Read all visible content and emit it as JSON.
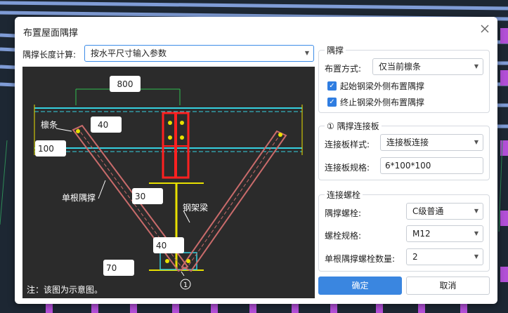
{
  "dialog": {
    "title": "布置屋面隅撑",
    "length_calc_label": "隅撑长度计算:",
    "length_calc_value": "按水平尺寸输入参数"
  },
  "diagram": {
    "dim_800": "800",
    "dim_40_top": "40",
    "dim_100": "100",
    "purlin_label": "檩条",
    "single_brace_label": "单根隅撑",
    "dim_30": "30",
    "steel_beam_label": "钢架梁",
    "dim_40_mid": "40",
    "dim_70": "70",
    "circle_marker": "1",
    "note": "注：该图为示意图。"
  },
  "brace_group": {
    "title": "隅撑",
    "layout_label": "布置方式:",
    "layout_value": "仅当前檩条",
    "check_start": "起始钢梁外侧布置隅撑",
    "check_end": "终止钢梁外侧布置隅撑",
    "check_start_checked": true,
    "check_end_checked": true
  },
  "plate_group": {
    "title": "① 隅撑连接板",
    "style_label": "连接板样式:",
    "style_value": "连接板连接",
    "spec_label": "连接板规格:",
    "spec_value": "6*100*100"
  },
  "bolt_group": {
    "title": "连接螺栓",
    "brace_bolt_label": "隅撑螺栓:",
    "brace_bolt_value": "C级普通",
    "bolt_spec_label": "螺栓规格:",
    "bolt_spec_value": "M12",
    "bolt_count_label": "单根隅撑螺栓数量:",
    "bolt_count_value": "2"
  },
  "buttons": {
    "ok": "确定",
    "cancel": "取消"
  },
  "colors": {
    "primary": "#3a86e0",
    "diagram_bg": "#2b2b2b"
  }
}
